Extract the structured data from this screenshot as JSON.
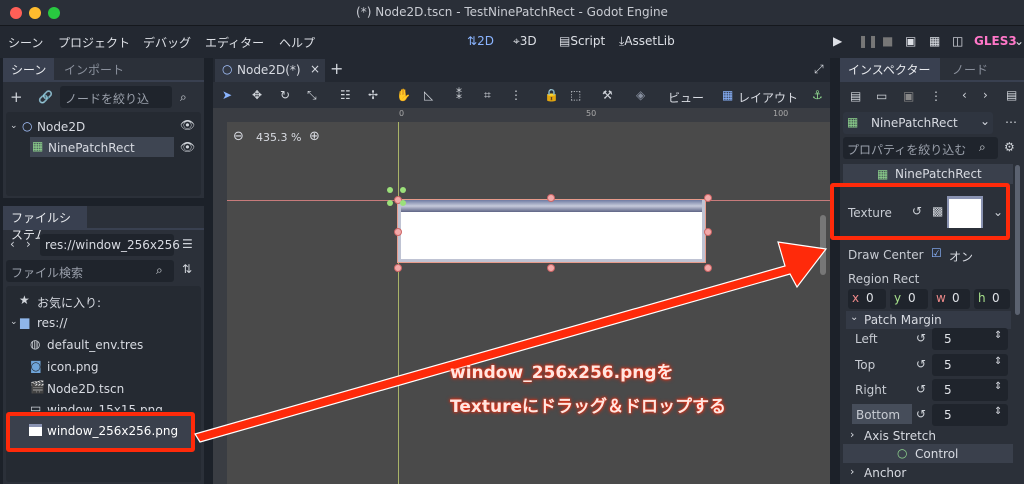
{
  "window": {
    "title": "(*) Node2D.tscn - TestNinePatchRect - Godot Engine"
  },
  "menu": [
    "シーン",
    "プロジェクト",
    "デバッグ",
    "エディター",
    "ヘルプ"
  ],
  "workspaces": [
    {
      "label": "2D",
      "icon": "2d-icon"
    },
    {
      "label": "3D",
      "icon": "3d-icon"
    },
    {
      "label": "Script",
      "icon": "script-icon"
    },
    {
      "label": "AssetLib",
      "icon": "assetlib-icon"
    }
  ],
  "renderer": "GLES3",
  "scene_dock": {
    "tabs": [
      "シーン",
      "インポート"
    ],
    "filter_placeholder": "ノードを絞り込",
    "tree": [
      {
        "label": "Node2D",
        "icon": "node2d-icon"
      },
      {
        "label": "NinePatchRect",
        "icon": "ninepatch-icon"
      }
    ]
  },
  "filesystem_dock": {
    "tab": "ファイルシステム",
    "path": "res://window_256x256",
    "search_placeholder": "ファイル検索",
    "items": [
      {
        "label": "お気に入り:",
        "icon": "star-icon"
      },
      {
        "label": "res://",
        "icon": "folder-icon"
      },
      {
        "label": "default_env.tres",
        "icon": "env-icon"
      },
      {
        "label": "icon.png",
        "icon": "image-icon"
      },
      {
        "label": "Node2D.tscn",
        "icon": "scene-icon"
      },
      {
        "label": "window_15x15.png",
        "icon": "image-icon"
      },
      {
        "label": "window_256x256.png",
        "icon": "image-icon"
      }
    ]
  },
  "editor_tab": {
    "label": "Node2D(*)"
  },
  "toolbar": {
    "view_label": "ビュー",
    "layout_label": "レイアウト"
  },
  "viewport": {
    "zoom": "435.3 %",
    "ruler_ticks": [
      "0",
      "50",
      "100"
    ]
  },
  "inspector": {
    "tabs": [
      "インスペクター",
      "ノード"
    ],
    "node_name": "NinePatchRect",
    "filter_placeholder": "プロパティを絞り込む",
    "section": "NinePatchRect",
    "texture_label": "Texture",
    "draw_center_label": "Draw Center",
    "draw_center_value": "オン",
    "region_rect_label": "Region Rect",
    "region": [
      {
        "k": "x",
        "v": "0"
      },
      {
        "k": "y",
        "v": "0"
      },
      {
        "k": "w",
        "v": "0"
      },
      {
        "k": "h",
        "v": "0"
      }
    ],
    "patch_margin_label": "Patch Margin",
    "margins": [
      {
        "label": "Left",
        "value": "5"
      },
      {
        "label": "Top",
        "value": "5"
      },
      {
        "label": "Right",
        "value": "5"
      },
      {
        "label": "Bottom",
        "value": "5"
      }
    ],
    "axis_stretch_label": "Axis Stretch",
    "control_label": "Control",
    "anchor_label": "Anchor"
  },
  "annotation": {
    "line1": "window_256x256.pngを",
    "line2": "Textureにドラッグ＆ドロップする"
  },
  "colors": {
    "accent": "#8ab4ff",
    "annotation_red": "#ff2a0a",
    "panel": "#2b3039",
    "viewport": "#4a4a4a"
  }
}
